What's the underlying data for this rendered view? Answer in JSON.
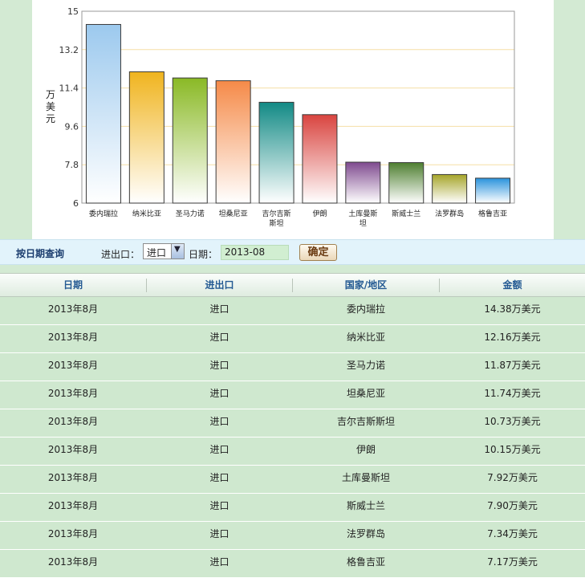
{
  "chart_data": {
    "type": "bar",
    "ylabel": "万美元",
    "ylim": [
      6,
      15
    ],
    "yticks": [
      "15",
      "13.2",
      "11.4",
      "9.6",
      "7.8",
      "6"
    ],
    "categories": [
      "委内瑞拉",
      "纳米比亚",
      "圣马力诺",
      "坦桑尼亚",
      "吉尔吉斯斯坦",
      "伊朗",
      "土库曼斯坦",
      "斯威士兰",
      "法罗群岛",
      "格鲁吉亚"
    ],
    "values": [
      14.38,
      12.16,
      11.87,
      11.74,
      10.73,
      10.15,
      7.92,
      7.9,
      7.34,
      7.17
    ],
    "colors": [
      "#9cc9ee",
      "#f0b41e",
      "#8ab925",
      "#f58a48",
      "#128a85",
      "#d9443f",
      "#7f4a8f",
      "#4e7f30",
      "#a6a52a",
      "#2a93dc"
    ],
    "grid": true,
    "legend": "none"
  },
  "query": {
    "title": "按日期查询",
    "io_label": "进出口：",
    "io_selected": "进口",
    "date_label": "日期：",
    "date_value": "2013-08",
    "submit_label": "确定"
  },
  "table": {
    "headers": [
      "日期",
      "进出口",
      "国家/地区",
      "金额"
    ],
    "rows": [
      [
        "2013年8月",
        "进口",
        "委内瑞拉",
        "14.38万美元"
      ],
      [
        "2013年8月",
        "进口",
        "纳米比亚",
        "12.16万美元"
      ],
      [
        "2013年8月",
        "进口",
        "圣马力诺",
        "11.87万美元"
      ],
      [
        "2013年8月",
        "进口",
        "坦桑尼亚",
        "11.74万美元"
      ],
      [
        "2013年8月",
        "进口",
        "吉尔吉斯斯坦",
        "10.73万美元"
      ],
      [
        "2013年8月",
        "进口",
        "伊朗",
        "10.15万美元"
      ],
      [
        "2013年8月",
        "进口",
        "土库曼斯坦",
        "7.92万美元"
      ],
      [
        "2013年8月",
        "进口",
        "斯威士兰",
        "7.90万美元"
      ],
      [
        "2013年8月",
        "进口",
        "法罗群岛",
        "7.34万美元"
      ],
      [
        "2013年8月",
        "进口",
        "格鲁吉亚",
        "7.17万美元"
      ]
    ]
  }
}
